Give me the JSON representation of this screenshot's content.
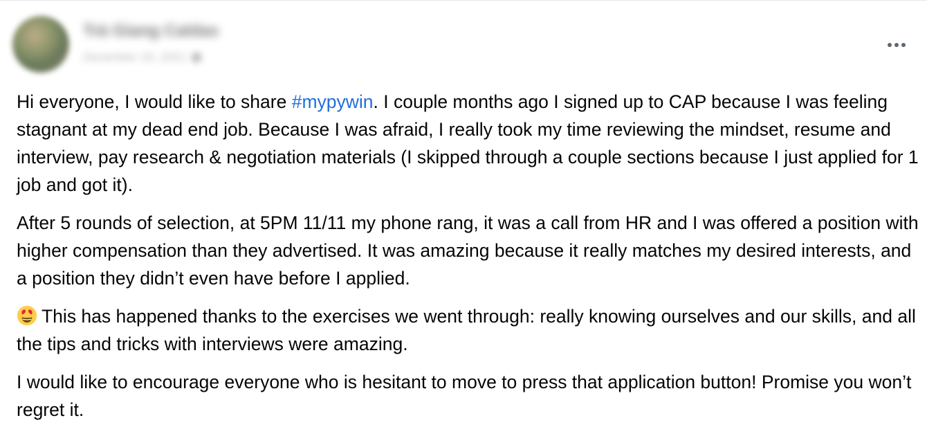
{
  "post": {
    "author_name": "Trà Giang Caldas",
    "timestamp": "December 16, 2021",
    "privacy_icon": "globe-icon",
    "more_icon": "more-options-icon",
    "paragraphs": {
      "p1": {
        "before": "Hi everyone, I would like to share ",
        "hashtag": "#mypywin",
        "after": ". I couple months ago I signed up to CAP because I was feeling stagnant at my dead end job. Because I was afraid, I really took my time reviewing the mindset, resume and interview, pay research & negotiation materials (I skipped through a couple sections because I just applied for 1 job and got it)."
      },
      "p2": "After 5 rounds of selection, at 5PM 11/11 my phone rang, it was a call from HR and I was offered a position with higher compensation than they advertised. It was amazing because it really matches my desired interests, and a position they didn’t even have before I applied.",
      "p3": {
        "emoji": "heart-eyes-emoji",
        "text": "This has happened thanks to the exercises we went through: really knowing ourselves and our skills, and all the tips and tricks with interviews were amazing."
      },
      "p4": "I would like to encourage everyone who is hesitant to move to press that application button! Promise you won’t regret it."
    },
    "colors": {
      "hashtag": "#216fdb",
      "text": "#050505",
      "secondary": "#65676b"
    }
  }
}
